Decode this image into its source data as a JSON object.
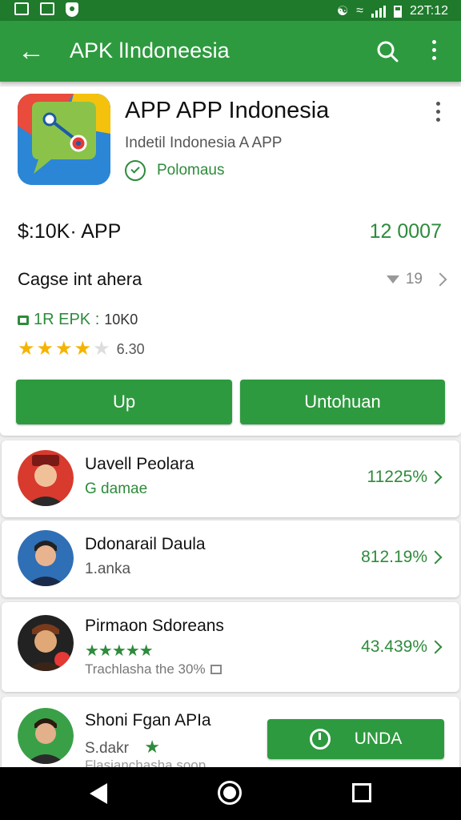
{
  "statusbar": {
    "time": "22T:12"
  },
  "appbar": {
    "title": "APK lIndoneesia"
  },
  "app": {
    "title": "APP  APP Indonesia",
    "subtitle": "Indetil Indonesia A APP",
    "verified_label": "Polomaus"
  },
  "details": {
    "price_label": "$:10K· APP",
    "price_value": "12 0007",
    "category_label": "Cagse int  ahera",
    "category_count": "19",
    "size_label": "1R EPK :",
    "size_value": "10K0",
    "rating_stars": 4,
    "rating_value": "6.30"
  },
  "buttons": {
    "primary": "Up",
    "secondary": "Untohuan"
  },
  "list": [
    {
      "name": "Uavell Peolara",
      "subtitle": "G damae",
      "value": "11225%"
    },
    {
      "name": "Ddonarail Daula",
      "subtitle": "1.anka",
      "value": "812.19%"
    },
    {
      "name": "Pirmaon Sdoreans",
      "stars": "★★★★★",
      "note": "Trachlasha the 30%",
      "value": "43.439%"
    },
    {
      "name": "Shoni Fgan APIa",
      "subtitle": "S.dakr",
      "note": "Flasianchasha soop",
      "button": "UNDA"
    }
  ],
  "colors": {
    "statusbar": "#1f7a2c",
    "appbar": "#2e9a3f",
    "accent": "#2e8b3c",
    "star": "#f5b400"
  },
  "icons": [
    "back-arrow-icon",
    "search-icon",
    "more-vert-icon",
    "verified-check-icon",
    "dropdown-triangle-icon",
    "chevron-right-icon",
    "lock-icon",
    "star-icon",
    "message-icon",
    "timer-icon"
  ]
}
